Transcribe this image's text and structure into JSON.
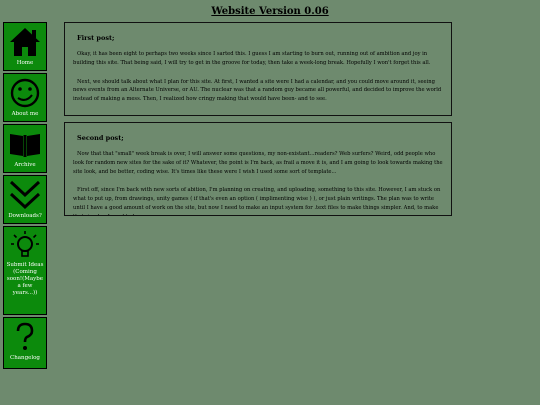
{
  "site": {
    "title": "Website Version 0.06"
  },
  "sidebar": {
    "items": [
      {
        "label": "Home",
        "icon": "home-icon"
      },
      {
        "label": "About me",
        "icon": "face-icon"
      },
      {
        "label": "Archive",
        "icon": "book-icon"
      },
      {
        "label": "Downloads?",
        "icon": "chevron-down-icon"
      },
      {
        "label": "Submit Ideas (Coming soon!(Maybe a few years...))",
        "icon": "lightbulb-icon"
      },
      {
        "label": "Changelog",
        "icon": "question-mark-icon"
      }
    ]
  },
  "posts": [
    {
      "title": "First post;",
      "paragraphs": [
        "Okay, it has been eight to perhaps two weeks since I sarted this. I guess I am starting to burn out, running out of ambition and joy in building this site. That being said, I will try to get in the groove for today, then take a week-long break. Hopefully I won't forget this all.",
        "Next, we should talk about what I plan for this site. At first, I wanted a site were I had a calendar, and you could move around it, seeing news events from an Alternate Universe, or AU. The nuclear was that a random guy became all powerful, and decided to improve the world instead of making a mess. Then, I realized how cringy making that would have been- and to see."
      ]
    },
    {
      "title": "Second post;",
      "paragraphs": [
        "Now that that \"small\" week break is over, I will answer some questions, my non-existant...readers? Web surfers? Weird, odd people who look for random new sites for the sake of it? Whatever, the point is I'm back, as frail a move it is, and I am going to look towards making the site look, and be better, coding wise. It's times like these were I wish I used some sort of template...",
        "First off, since I'm back with new sorts of abition, I'm planning on creating, and uploading, something to this site. However, I am stuck on what to put up, from drawings, unity games ( if that's even an option ( implimenting wise ) ), or just plain writings. The plan was to write until I have a good amount of work on the site, but now I need to make an input system for .text files to make things simpler. And, to make that simpler, I need to learn"
      ]
    }
  ]
}
